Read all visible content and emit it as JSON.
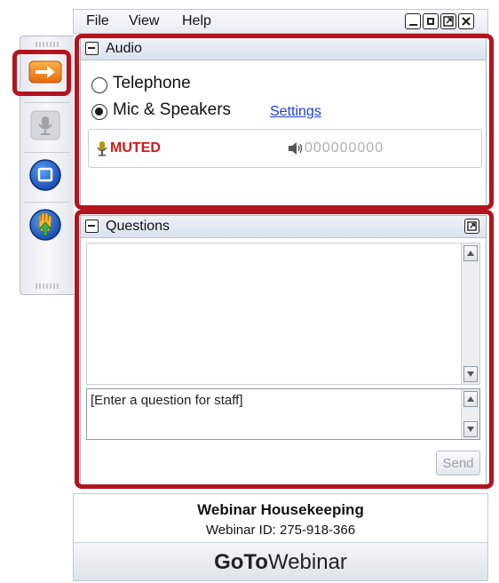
{
  "menu": {
    "file": "File",
    "view": "View",
    "help": "Help"
  },
  "window_controls": [
    "minimize",
    "restore",
    "popout",
    "close"
  ],
  "audio": {
    "title": "Audio",
    "options": [
      {
        "label": "Telephone",
        "selected": false
      },
      {
        "label": "Mic & Speakers",
        "selected": true
      }
    ],
    "settings_link": "Settings",
    "mute_status": "MUTED",
    "level_meter": "000000000"
  },
  "questions": {
    "title": "Questions",
    "input_text": "[Enter a question for staff]",
    "send_label": "Send"
  },
  "footer": {
    "webinar_title": "Webinar Housekeeping",
    "webinar_id": "Webinar ID: 275-918-366",
    "brand_bold": "GoTo",
    "brand_light": "Webinar"
  },
  "colors": {
    "highlight": "#b3141e",
    "accent_orange": "#f07d18",
    "muted_red": "#cc1a1a",
    "link_blue": "#1a3fd6",
    "panel_blue": "#d9e2ee"
  },
  "icons": {
    "show_panel": "arrow-right-icon",
    "microphone": "microphone-icon",
    "screen": "screen-icon",
    "raise_hand": "raise-hand-icon",
    "speaker": "speaker-icon"
  }
}
